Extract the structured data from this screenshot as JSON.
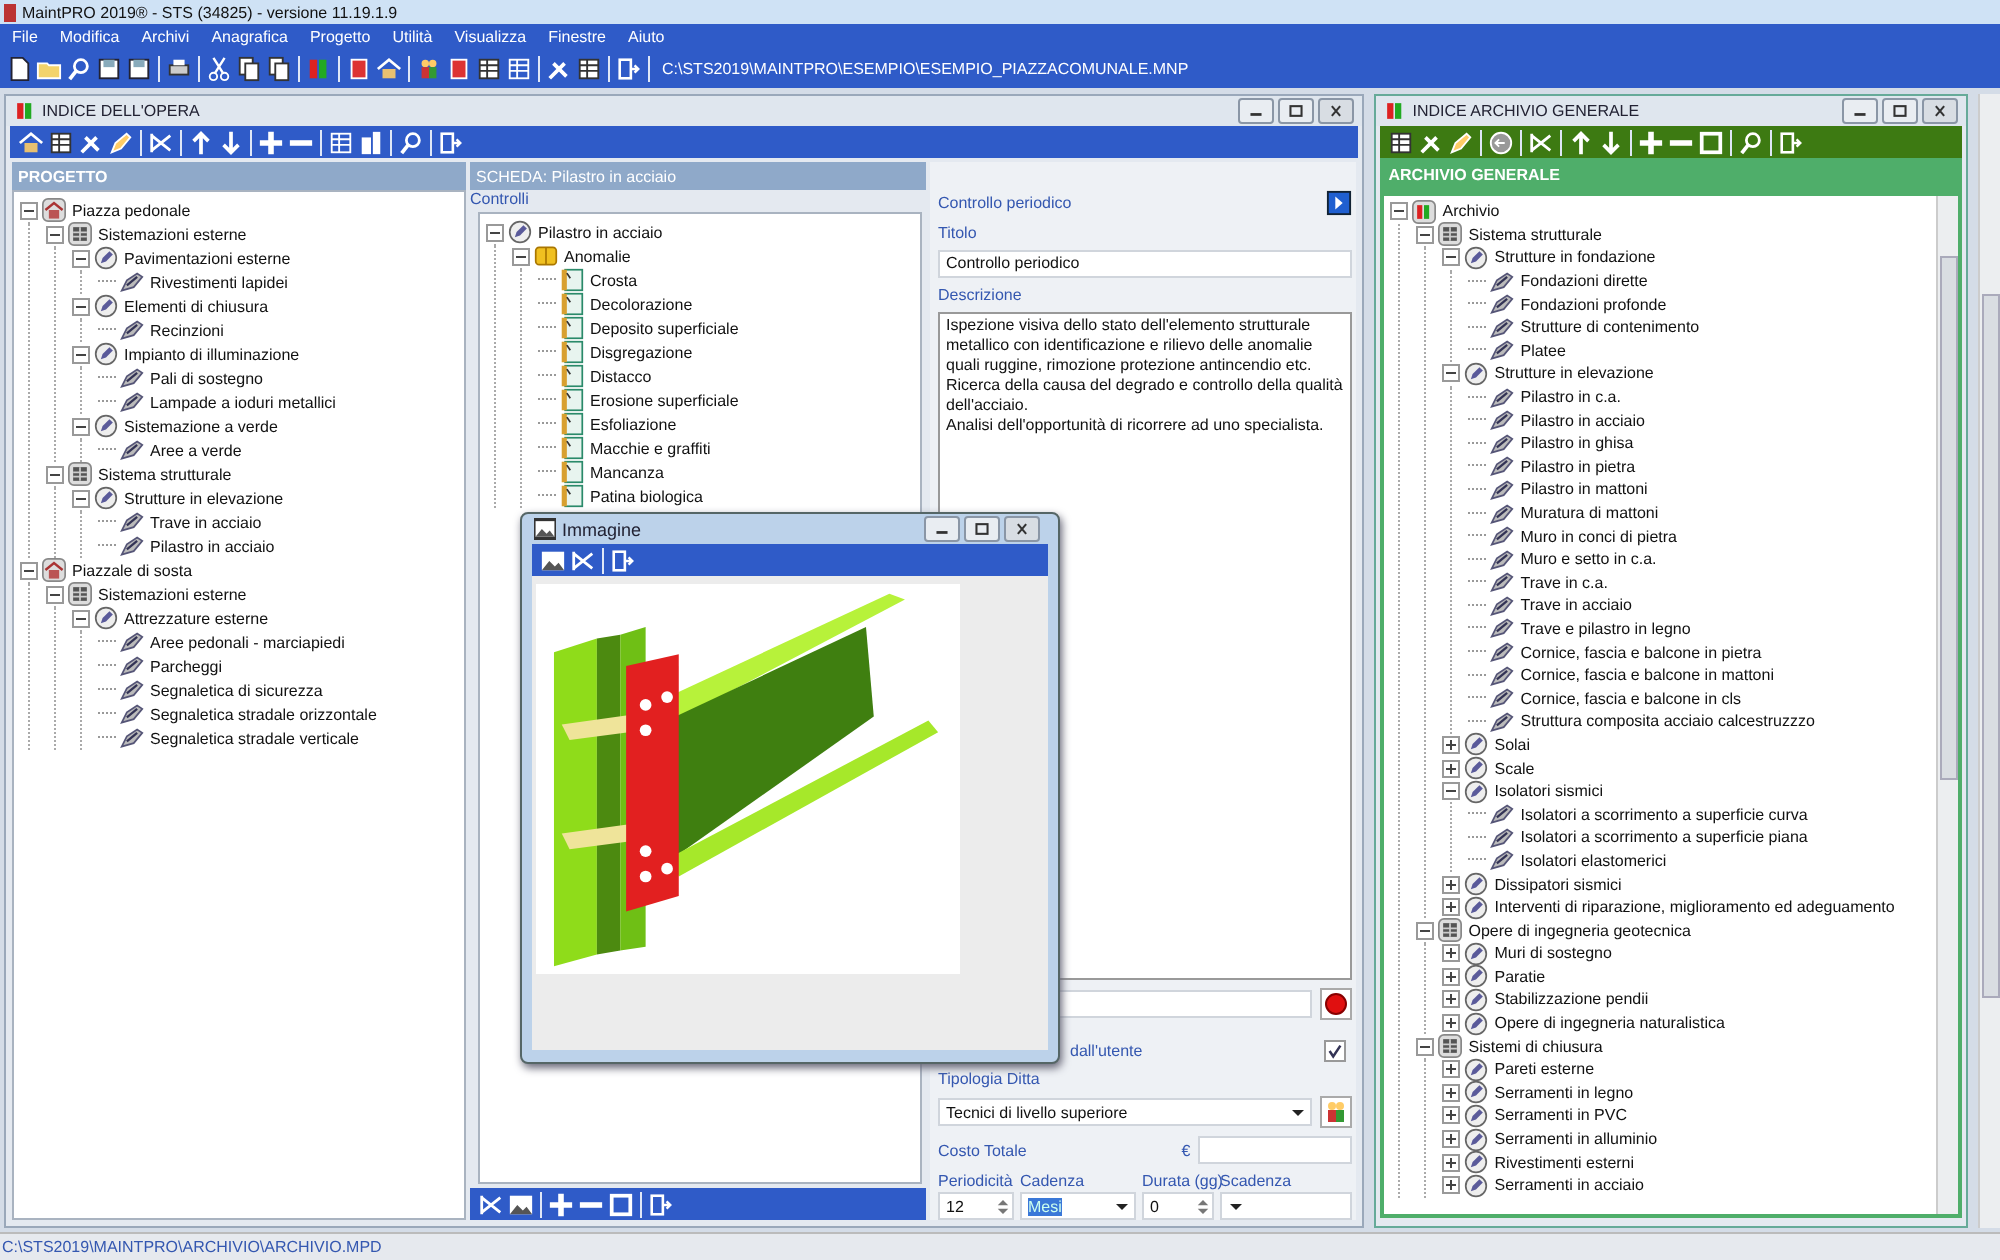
{
  "window": {
    "title": "MaintPRO 2019® - STS (34825) - versione 11.19.1.9"
  },
  "menu": [
    "File",
    "Modifica",
    "Archivi",
    "Anagrafica",
    "Progetto",
    "Utilità",
    "Visualizza",
    "Finestre",
    "Aiuto"
  ],
  "toolbar": {
    "path": "C:\\STS2019\\MAINTPRO\\ESEMPIO\\ESEMPIO_PIAZZACOMUNALE.MNP"
  },
  "opera_window": {
    "title": "INDICE DELL'OPERA",
    "project_panel": {
      "header": "PROGETTO",
      "tree": [
        {
          "label": "Piazza pedonale",
          "kind": "opera",
          "expanded": true,
          "children": [
            {
              "label": "Sistemazioni esterne",
              "kind": "sistema",
              "expanded": true,
              "children": [
                {
                  "label": "Pavimentazioni esterne",
                  "kind": "componente",
                  "expanded": true,
                  "children": [
                    {
                      "label": "Rivestimenti lapidei",
                      "kind": "elemento"
                    }
                  ]
                },
                {
                  "label": "Elementi di chiusura",
                  "kind": "componente",
                  "expanded": true,
                  "children": [
                    {
                      "label": "Recinzioni",
                      "kind": "elemento"
                    }
                  ]
                },
                {
                  "label": "Impianto di illuminazione",
                  "kind": "componente",
                  "expanded": true,
                  "children": [
                    {
                      "label": "Pali di sostegno",
                      "kind": "elemento"
                    },
                    {
                      "label": "Lampade a ioduri metallici",
                      "kind": "elemento"
                    }
                  ]
                },
                {
                  "label": "Sistemazione a verde",
                  "kind": "componente",
                  "expanded": true,
                  "children": [
                    {
                      "label": "Aree a verde",
                      "kind": "elemento"
                    }
                  ]
                }
              ]
            },
            {
              "label": "Sistema strutturale",
              "kind": "sistema",
              "expanded": true,
              "children": [
                {
                  "label": "Strutture in elevazione",
                  "kind": "componente",
                  "expanded": true,
                  "children": [
                    {
                      "label": "Trave in acciaio",
                      "kind": "elemento"
                    },
                    {
                      "label": "Pilastro in acciaio",
                      "kind": "elemento"
                    }
                  ]
                }
              ]
            }
          ]
        },
        {
          "label": "Piazzale di sosta",
          "kind": "opera",
          "expanded": true,
          "children": [
            {
              "label": "Sistemazioni esterne",
              "kind": "sistema",
              "expanded": true,
              "children": [
                {
                  "label": "Attrezzature esterne",
                  "kind": "componente",
                  "expanded": true,
                  "children": [
                    {
                      "label": "Aree pedonali - marciapiedi",
                      "kind": "elemento"
                    },
                    {
                      "label": "Parcheggi",
                      "kind": "elemento"
                    },
                    {
                      "label": "Segnaletica di sicurezza",
                      "kind": "elemento"
                    },
                    {
                      "label": "Segnaletica stradale orizzontale",
                      "kind": "elemento"
                    },
                    {
                      "label": "Segnaletica stradale verticale",
                      "kind": "elemento"
                    }
                  ]
                }
              ]
            }
          ]
        }
      ]
    },
    "scheda": {
      "header": "SCHEDA: Pilastro in acciaio",
      "controls_label": "Controlli",
      "tree": [
        {
          "label": "Pilastro in acciaio",
          "kind": "componente",
          "expanded": true,
          "children": [
            {
              "label": "Anomalie",
              "kind": "gruppo",
              "expanded": true,
              "children": [
                {
                  "label": "Crosta",
                  "kind": "anomalia"
                },
                {
                  "label": "Decolorazione",
                  "kind": "anomalia"
                },
                {
                  "label": "Deposito superficiale",
                  "kind": "anomalia"
                },
                {
                  "label": "Disgregazione",
                  "kind": "anomalia"
                },
                {
                  "label": "Distacco",
                  "kind": "anomalia"
                },
                {
                  "label": "Erosione superficiale",
                  "kind": "anomalia"
                },
                {
                  "label": "Esfoliazione",
                  "kind": "anomalia"
                },
                {
                  "label": "Macchie e graffiti",
                  "kind": "anomalia"
                },
                {
                  "label": "Mancanza",
                  "kind": "anomalia"
                },
                {
                  "label": "Patina biologica",
                  "kind": "anomalia"
                }
              ]
            }
          ]
        }
      ]
    },
    "form": {
      "heading": "Controllo periodico",
      "title_label": "Titolo",
      "title_value": "Controllo periodico",
      "description_label": "Descrizione",
      "description": "Ispezione visiva dello stato dell'elemento strutturale metallico con identificazione e rilievo delle anomalie quali ruggine, rimozione protezione antincendio etc.\nRicerca della causa del degrado e controllo della qualità dell'acciaio.\nAnalisi dell'opportunità di ricorrere ad uno specialista.",
      "user_label": "dall'utente",
      "user_checked": true,
      "company_label": "Tipologia Ditta",
      "company_value": "Tecnici di livello superiore",
      "cost_label": "Costo Totale",
      "currency": "€",
      "periodicity_label": "Periodicità",
      "cadence_label": "Cadenza",
      "duration_label": "Durata (gg)",
      "due_label": "Scadenza",
      "periodicity_value": "12",
      "cadence_value": "Mesi",
      "duration_value": "0"
    }
  },
  "image_window": {
    "title": "Immagine"
  },
  "archive_window": {
    "title": "INDICE ARCHIVIO GENERALE",
    "header": "ARCHIVIO GENERALE",
    "tree": [
      {
        "label": "Archivio",
        "kind": "archivio",
        "expanded": true,
        "children": [
          {
            "label": "Sistema strutturale",
            "kind": "sistema",
            "expanded": true,
            "children": [
              {
                "label": "Strutture in fondazione",
                "kind": "componente",
                "expanded": true,
                "children": [
                  {
                    "label": "Fondazioni dirette",
                    "kind": "elemento"
                  },
                  {
                    "label": "Fondazioni profonde",
                    "kind": "elemento"
                  },
                  {
                    "label": "Strutture di contenimento",
                    "kind": "elemento"
                  },
                  {
                    "label": "Platee",
                    "kind": "elemento"
                  }
                ]
              },
              {
                "label": "Strutture in elevazione",
                "kind": "componente",
                "expanded": true,
                "children": [
                  {
                    "label": "Pilastro in c.a.",
                    "kind": "elemento"
                  },
                  {
                    "label": "Pilastro in acciaio",
                    "kind": "elemento"
                  },
                  {
                    "label": "Pilastro in ghisa",
                    "kind": "elemento"
                  },
                  {
                    "label": "Pilastro in pietra",
                    "kind": "elemento"
                  },
                  {
                    "label": "Pilastro in mattoni",
                    "kind": "elemento"
                  },
                  {
                    "label": "Muratura di mattoni",
                    "kind": "elemento"
                  },
                  {
                    "label": "Muro in conci di pietra",
                    "kind": "elemento"
                  },
                  {
                    "label": "Muro e setto in c.a.",
                    "kind": "elemento"
                  },
                  {
                    "label": "Trave in c.a.",
                    "kind": "elemento"
                  },
                  {
                    "label": "Trave in acciaio",
                    "kind": "elemento"
                  },
                  {
                    "label": "Trave e pilastro in legno",
                    "kind": "elemento"
                  },
                  {
                    "label": "Cornice, fascia e balcone in pietra",
                    "kind": "elemento"
                  },
                  {
                    "label": "Cornice, fascia e balcone in mattoni",
                    "kind": "elemento"
                  },
                  {
                    "label": "Cornice, fascia e balcone in cls",
                    "kind": "elemento"
                  },
                  {
                    "label": "Struttura composita acciaio calcestruzzzo",
                    "kind": "elemento"
                  }
                ]
              },
              {
                "label": "Solai",
                "kind": "componente",
                "expanded": false
              },
              {
                "label": "Scale",
                "kind": "componente",
                "expanded": false
              },
              {
                "label": "Isolatori sismici",
                "kind": "componente",
                "expanded": true,
                "children": [
                  {
                    "label": "Isolatori a scorrimento a superficie curva",
                    "kind": "elemento"
                  },
                  {
                    "label": "Isolatori a scorrimento a superficie piana",
                    "kind": "elemento"
                  },
                  {
                    "label": "Isolatori elastomerici",
                    "kind": "elemento"
                  }
                ]
              },
              {
                "label": "Dissipatori sismici",
                "kind": "componente",
                "expanded": false
              },
              {
                "label": "Interventi di riparazione, miglioramento ed adeguamento",
                "kind": "componente",
                "expanded": false
              }
            ]
          },
          {
            "label": "Opere di ingegneria geotecnica",
            "kind": "sistema",
            "expanded": true,
            "children": [
              {
                "label": "Muri di sostegno",
                "kind": "componente",
                "expanded": false
              },
              {
                "label": "Paratie",
                "kind": "componente",
                "expanded": false
              },
              {
                "label": "Stabilizzazione pendii",
                "kind": "componente",
                "expanded": false
              },
              {
                "label": "Opere di ingegneria naturalistica",
                "kind": "componente",
                "expanded": false
              }
            ]
          },
          {
            "label": "Sistemi di chiusura",
            "kind": "sistema",
            "expanded": true,
            "children": [
              {
                "label": "Pareti esterne",
                "kind": "componente",
                "expanded": false
              },
              {
                "label": "Serramenti in legno",
                "kind": "componente",
                "expanded": false
              },
              {
                "label": "Serramenti in PVC",
                "kind": "componente",
                "expanded": false
              },
              {
                "label": "Serramenti in alluminio",
                "kind": "componente",
                "expanded": false
              },
              {
                "label": "Rivestimenti esterni",
                "kind": "componente",
                "expanded": false
              },
              {
                "label": "Serramenti in acciaio",
                "kind": "componente",
                "expanded": false
              }
            ]
          }
        ]
      }
    ]
  },
  "status_bar": {
    "path": "C:\\STS2019\\MAINTPRO\\ARCHIVIO\\ARCHIVIO.MPD"
  }
}
